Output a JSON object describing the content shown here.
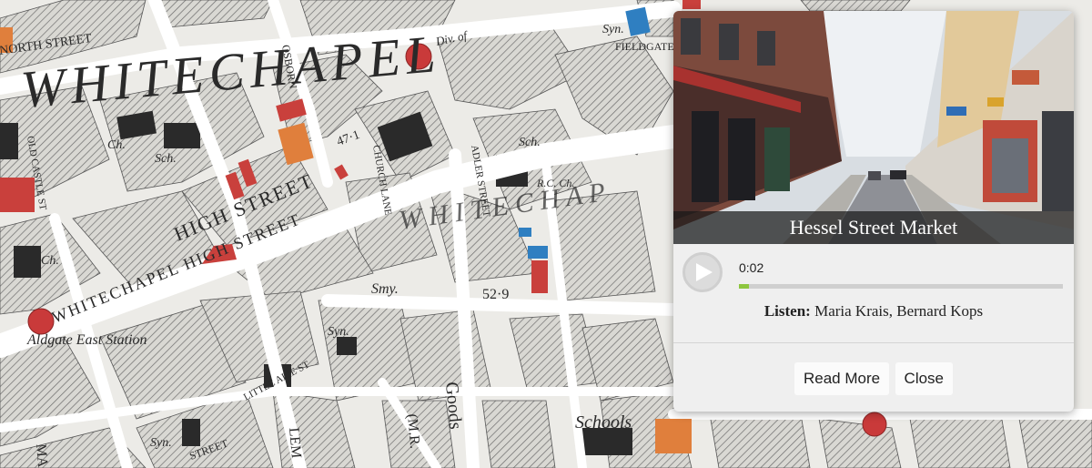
{
  "map": {
    "labels": {
      "district": "WHITECHAPEL",
      "district_faint": "W H I T E C H A P",
      "high_street": "HIGH STREET",
      "whitechapel_high": "WHITECHAPEL HIGH STREET",
      "station": "Aldgate East Station",
      "north_street": "NORTH STREET",
      "osborn": "OSBORN",
      "fieldgate": "FIELDGATE",
      "church_lane": "CHURCH LANE",
      "adler_street": "ADLER STREET",
      "old_castle": "OLD CASTLE ST",
      "goods": "Goods",
      "schools": "Schools",
      "syn": "Syn.",
      "syn2": "Syn.",
      "smy": "Smy.",
      "level": "52·9",
      "level2": "47·1",
      "ch1": "Ch.",
      "ch2": "Ch.",
      "sch": "Sch.",
      "sch2": "Sch.",
      "rc": "R.C. Ch.",
      "div": "Div. of",
      "mr": "(M.R.",
      "lem": "LEM",
      "ma": "MA",
      "little_alie": "LITTLE ALIE ST",
      "street": "STREET",
      "syn_top": "Syn."
    },
    "colors": {
      "red": "#c9403c",
      "orange": "#e07f3c",
      "blue": "#2f7fc1",
      "marker": "#c93a3a"
    }
  },
  "popup": {
    "title": "Hessel Street Market",
    "audio": {
      "current_time": "0:02",
      "progress": 0.03
    },
    "listen_label": "Listen:",
    "listen_names": "Maria Krais, Bernard Kops",
    "buttons": {
      "read_more": "Read More",
      "close": "Close"
    }
  }
}
